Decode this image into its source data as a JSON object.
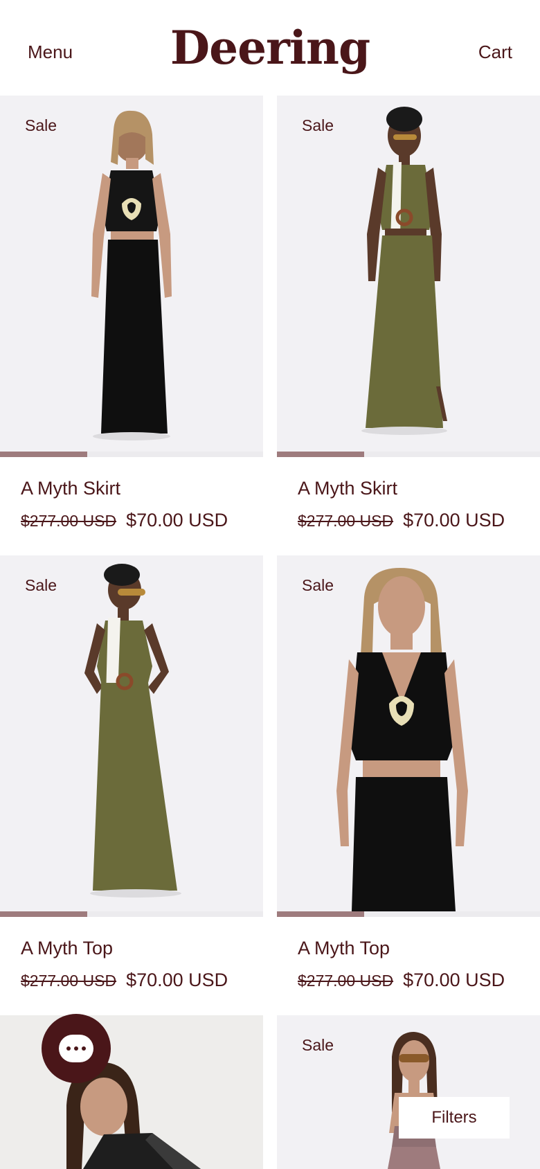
{
  "header": {
    "menu_label": "Menu",
    "brand": "Deering",
    "cart_label": "Cart"
  },
  "products": [
    {
      "badge": "Sale",
      "title": "A Myth Skirt",
      "price_original": "$277.00 USD",
      "price_sale": "$70.00 USD",
      "color": "black",
      "gallery_progress": 0.33
    },
    {
      "badge": "Sale",
      "title": "A Myth Skirt",
      "price_original": "$277.00 USD",
      "price_sale": "$70.00 USD",
      "color": "olive",
      "gallery_progress": 0.33
    },
    {
      "badge": "Sale",
      "title": "A Myth Top",
      "price_original": "$277.00 USD",
      "price_sale": "$70.00 USD",
      "color": "olive",
      "gallery_progress": 0.33
    },
    {
      "badge": "Sale",
      "title": "A Myth Top",
      "price_original": "$277.00 USD",
      "price_sale": "$70.00 USD",
      "color": "black",
      "gallery_progress": 0.33
    },
    {
      "badge": "",
      "color": "black-sheer"
    },
    {
      "badge": "Sale",
      "color": "mauve"
    }
  ],
  "chat": {
    "icon": "chat-bubble-icon"
  },
  "filters_label": "Filters",
  "colors": {
    "brand": "#4a1619",
    "image_bg": "#f2f1f4",
    "progress": "#9e7b7d",
    "olive": "#6b6b3a"
  }
}
